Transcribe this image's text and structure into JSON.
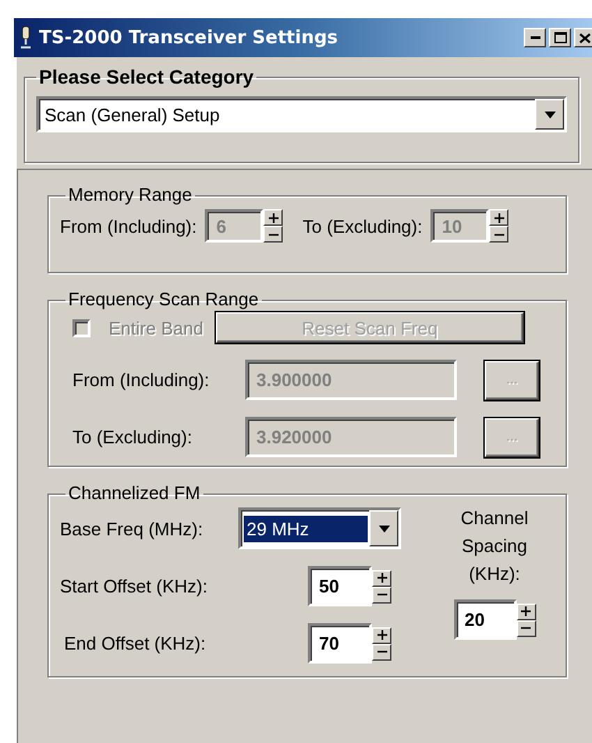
{
  "window": {
    "title": "TS-2000 Transceiver Settings"
  },
  "category": {
    "legend": "Please Select Category",
    "value": "Scan (General) Setup"
  },
  "memory_range": {
    "legend": "Memory Range",
    "fields": [
      {
        "label": "From (Including):",
        "value": "6",
        "disabled": true
      },
      {
        "label": "To (Excluding):",
        "value": "10",
        "disabled": true
      }
    ]
  },
  "frequency_scan_range": {
    "legend": "Frequency Scan Range",
    "entire_band": {
      "label": "Entire Band",
      "checked": false,
      "disabled": true
    },
    "reset_button": {
      "label": "Reset Scan Freq",
      "disabled": true
    },
    "fields": [
      {
        "label": "From (Including):",
        "value": "3.900000",
        "button": "...",
        "disabled": true
      },
      {
        "label": "To (Excluding):",
        "value": "3.920000",
        "button": "...",
        "disabled": true
      }
    ]
  },
  "channelized_fm": {
    "legend": "Channelized FM",
    "base_freq": {
      "label": "Base Freq (MHz):",
      "value": "29 MHz",
      "highlighted": true
    },
    "offsets": [
      {
        "label": "Start Offset (KHz):",
        "value": "50",
        "disabled": false
      },
      {
        "label": "End Offset (KHz):",
        "value": "70",
        "disabled": false
      }
    ],
    "channel_spacing": {
      "label": "Channel Spacing (KHz):",
      "value": "20",
      "disabled": false
    }
  }
}
